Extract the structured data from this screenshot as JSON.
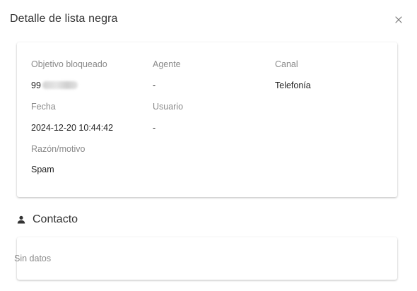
{
  "dialog": {
    "title": "Detalle de lista negra",
    "close_icon": "close-icon"
  },
  "detail": {
    "target_label": "Objetivo bloqueado",
    "target_value_visible": "99",
    "agent_label": "Agente",
    "agent_value": "-",
    "channel_label": "Canal",
    "channel_value": "Telefonía",
    "date_label": "Fecha",
    "date_value": "2024-12-20 10:44:42",
    "user_label": "Usuario",
    "user_value": "-",
    "reason_label": "Razón/motivo",
    "reason_value": "Spam"
  },
  "contact": {
    "icon": "person-icon",
    "title": "Contacto",
    "empty_text": "Sin datos"
  },
  "colors": {
    "title_text": "#333333",
    "label_text": "#8a8a8a",
    "value_text": "#222222",
    "background": "#ffffff"
  }
}
